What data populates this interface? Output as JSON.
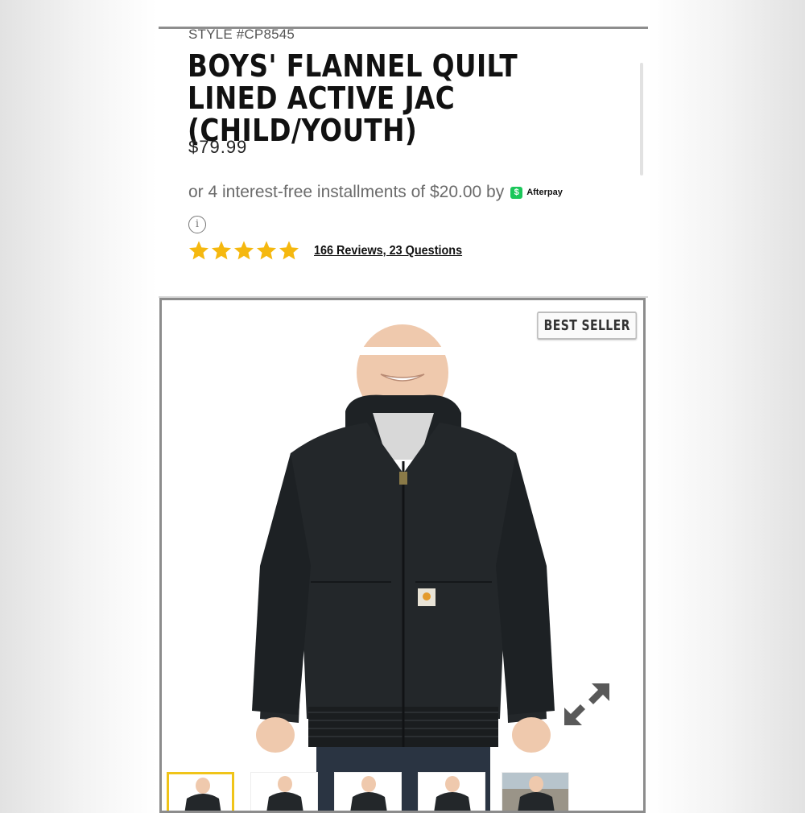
{
  "product": {
    "style_number": "STYLE #CP8545",
    "title": "BOYS' FLANNEL QUILT LINED ACTIVE JAC (CHILD/YOUTH)",
    "price": "$79.99",
    "installments_text": "or 4 interest-free installments of $20.00 by",
    "afterpay_label": "Afterpay",
    "afterpay_icon": "$",
    "info_icon": "i",
    "rating": 5,
    "rating_max": 5,
    "reviews_link": "166 Reviews, 23 Questions",
    "badge": "BEST SELLER"
  },
  "colors": {
    "star": "#f5b80f",
    "afterpay": "#1bc75a",
    "active_thumb_border": "#f0c419",
    "jacket": "#23272a"
  },
  "icons": {
    "expand": "expand-arrows-icon",
    "info": "info-circle-icon",
    "star": "star-icon"
  },
  "gallery": {
    "thumbnails": [
      "thumb-1",
      "thumb-2",
      "thumb-3",
      "thumb-4",
      "thumb-5"
    ],
    "active_index": 0
  }
}
